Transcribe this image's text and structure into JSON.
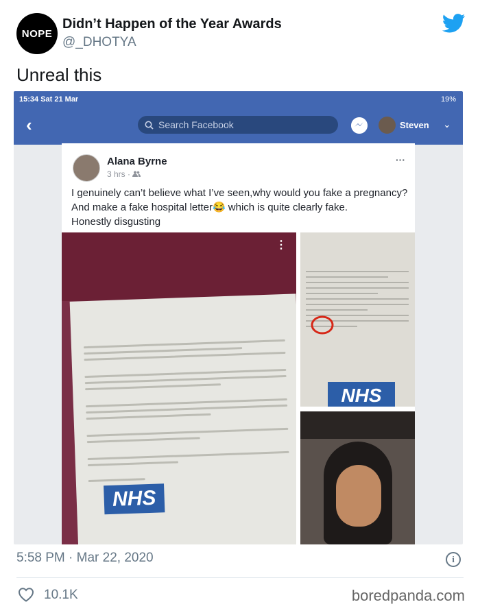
{
  "account": {
    "avatar_text": "NOPE",
    "name": "Didn’t Happen of the Year Awards",
    "handle": "@_DHOTYA"
  },
  "tweet": {
    "text": "Unreal this",
    "timestamp": "5:58 PM · Mar 22, 2020",
    "likes": "10.1K"
  },
  "screenshot": {
    "status": {
      "time": "15:34  Sat 21 Mar",
      "battery": "19%"
    },
    "nav": {
      "back": "‹",
      "search_placeholder": "Search Facebook",
      "user": "Steven",
      "chevron": "⌄"
    },
    "post": {
      "author": "Alana Byrne",
      "meta": "3 hrs ·",
      "dots": "···",
      "text_lines": [
        "I genuinely can’t believe what I’ve seen,why would you fake a pregnancy?",
        "And make a fake hospital letter😂 which is quite clearly fake.",
        "Honestly disgusting"
      ],
      "nhs_logo": "NHS",
      "image_menu": "⋮"
    }
  },
  "watermark": "boredpanda.com",
  "colors": {
    "facebook_blue": "#4267b2",
    "twitter_blue": "#1da1f2",
    "secondary_text": "#657786"
  },
  "icons": [
    "twitter-bird-icon",
    "search-icon",
    "messenger-icon",
    "info-icon",
    "heart-icon"
  ]
}
